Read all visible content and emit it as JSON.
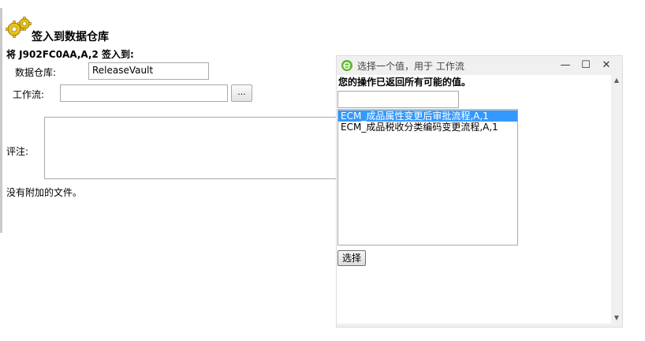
{
  "page": {
    "title": "签入到数据仓库",
    "subtitle": "将 J902FC0AA,A,2 签入到:"
  },
  "form": {
    "vault_label": "数据仓库:",
    "vault_value": "ReleaseVault",
    "workflow_label": "工作流:",
    "workflow_value": "",
    "browse_label": "...",
    "comment_label": "评注:",
    "attachments_text": "没有附加的文件。"
  },
  "popup": {
    "title": "选择一个值，用于 工作流",
    "message": "您的操作已返回所有可能的值。",
    "filter_value": "",
    "options": [
      {
        "label": "ECM_成品属性变更后审批流程,A,1",
        "selected": true
      },
      {
        "label": "ECM_成品税收分类编码变更流程,A,1",
        "selected": false
      }
    ],
    "select_label": "选择",
    "controls": {
      "minimize": "—",
      "maximize": "☐",
      "close": "✕"
    }
  },
  "icons": {
    "page_icon": "gears-icon",
    "popup_icon": "browser-e-icon"
  },
  "colors": {
    "selection": "#3399ff",
    "popup_icon": "#5cb82e",
    "gear": "#e8c21a"
  }
}
